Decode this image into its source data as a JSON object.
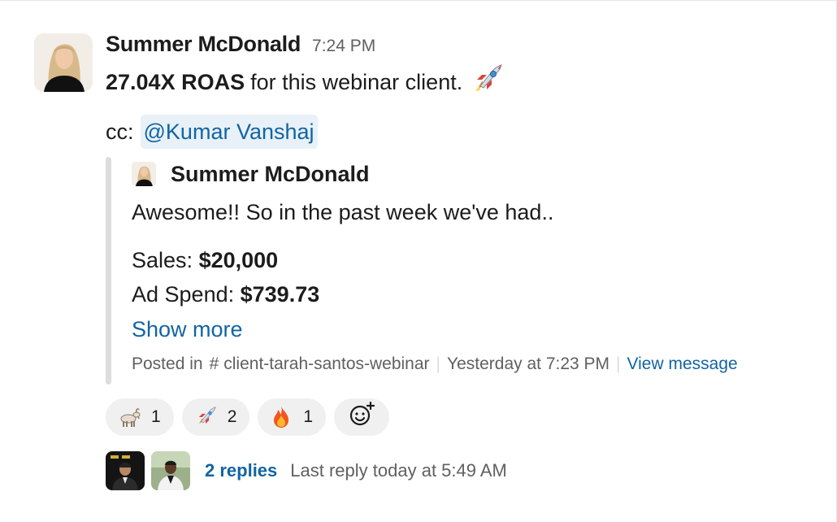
{
  "message": {
    "sender": "Summer McDonald",
    "time": "7:24 PM",
    "body_bold": "27.04X ROAS",
    "body_rest": "for this webinar client.",
    "body_emoji": "rocket-icon",
    "cc_label": "cc:",
    "mention": "@Kumar Vanshaj"
  },
  "quote": {
    "sender": "Summer McDonald",
    "text": "Awesome!! So in the past week we've had..",
    "sales_label": "Sales:",
    "sales_value": "$20,000",
    "spend_label": "Ad Spend:",
    "spend_value": "$739.73",
    "show_more": "Show more",
    "posted_in": "Posted in",
    "channel": "client-tarah-santos-webinar",
    "posted_time": "Yesterday at 7:23 PM",
    "view_message": "View message"
  },
  "reactions": [
    {
      "emoji": "goat-icon",
      "count": "1"
    },
    {
      "emoji": "rocket-icon",
      "count": "2"
    },
    {
      "emoji": "fire-icon",
      "count": "1"
    }
  ],
  "thread": {
    "reply_count": "2 replies",
    "last_reply": "Last reply today at 5:49 AM"
  },
  "colors": {
    "link": "#1264a3",
    "mention_bg": "#e8f1f8",
    "muted": "#616061",
    "reaction_bg": "#f0f0f0",
    "quote_bar": "#dddddd"
  }
}
